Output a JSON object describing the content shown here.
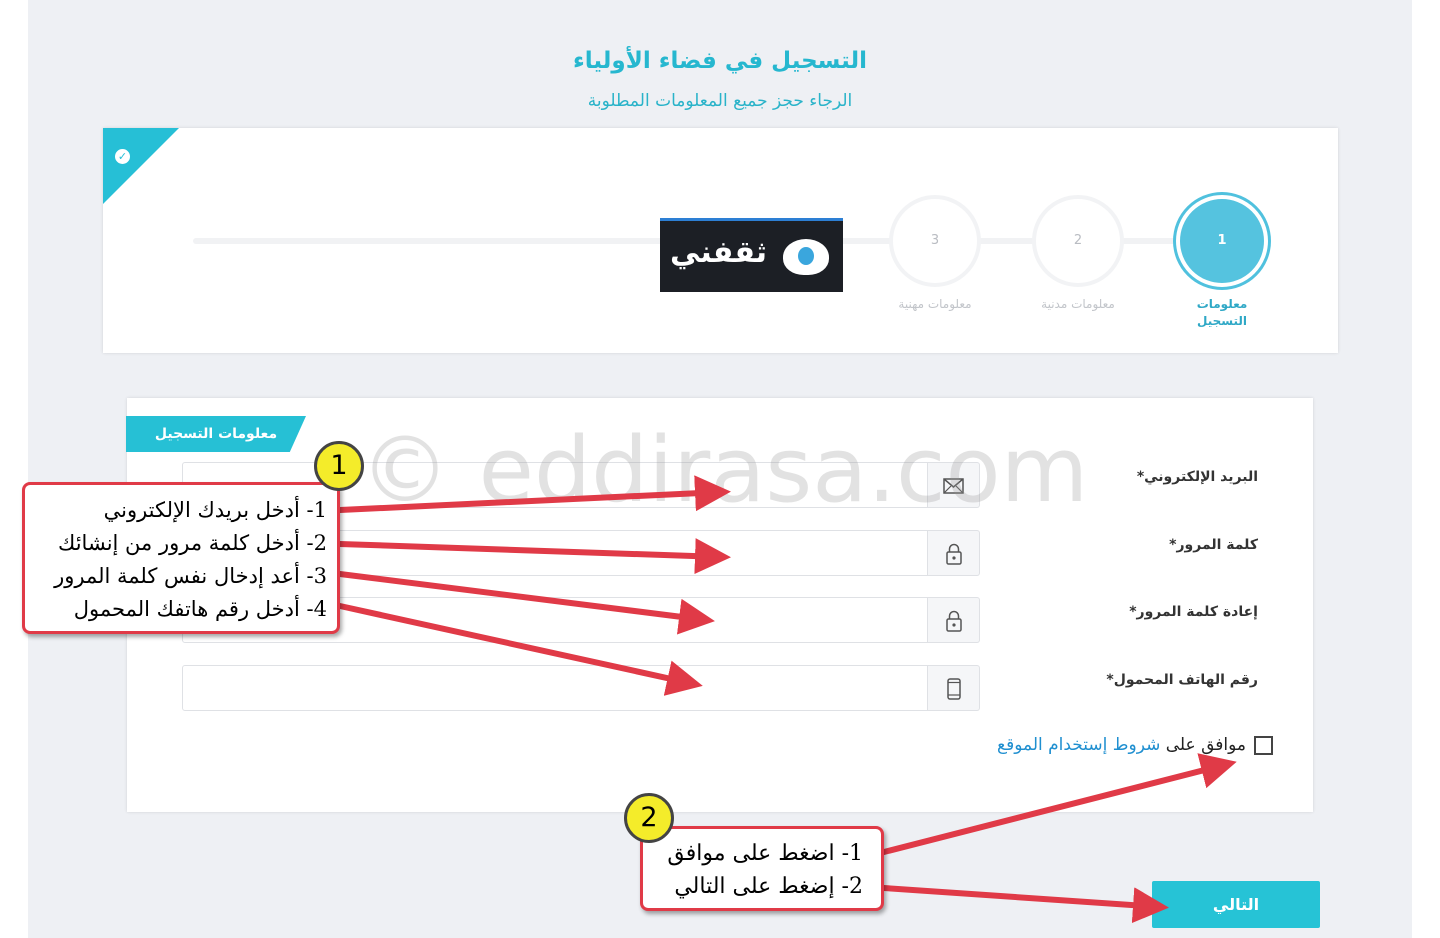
{
  "header": {
    "title": "التسجيل في فضاء الأولياء",
    "subtitle": "الرجاء حجز جميع المعلومات المطلوبة"
  },
  "steps": [
    {
      "number": "1",
      "label_line1": "معلومات",
      "label_line2": "التسجيل",
      "state": "active"
    },
    {
      "number": "2",
      "label_line1": "معلومات مدنية",
      "label_line2": "",
      "state": "pending"
    },
    {
      "number": "3",
      "label_line1": "معلومات مهنية",
      "label_line2": "",
      "state": "pending"
    }
  ],
  "logo": {
    "text": "ثقفني"
  },
  "form": {
    "section_tab": "معلومات التسجيل",
    "fields": [
      {
        "label": "البريد الإلكتروني*",
        "icon": "envelope-icon"
      },
      {
        "label": "كلمة المرور*",
        "icon": "lock-icon"
      },
      {
        "label": "إعادة كلمة المرور*",
        "icon": "lock-icon"
      },
      {
        "label": "رقم الهاتف المحمول*",
        "icon": "mobile-phone-icon"
      }
    ],
    "agree_text": "موافق على",
    "terms_link": "شروط إستخدام الموقع",
    "next_button": "التالي"
  },
  "watermark": "© eddirasa.com",
  "annotations": {
    "badge1": "1",
    "badge2": "2",
    "callout1": [
      "1- أدخل بريدك الإلكتروني",
      "2- أدخل كلمة مرور من إنشائك",
      "3- أعد إدخال نفس كلمة المرور",
      "4- أدخل رقم هاتفك المحمول"
    ],
    "callout2": [
      "1- اضغط على موافق",
      "2- إضغط على التالي"
    ]
  },
  "colors": {
    "accent": "#26c0d5",
    "annotation_red": "#e03a47",
    "badge_yellow": "#f4ec2a",
    "link": "#1f8fd0"
  }
}
